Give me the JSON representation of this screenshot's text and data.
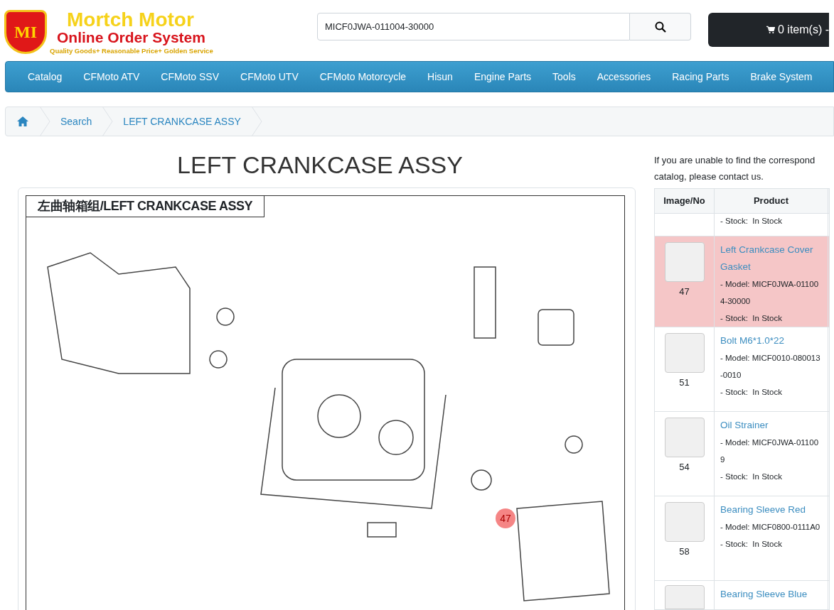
{
  "logo": {
    "mark": "MI",
    "name": "Mortch Motor",
    "subtitle": "Online Order System",
    "tagline": "Quality Goods+ Reasonable Price+ Golden Service"
  },
  "search": {
    "value": "MICF0JWA-011004-30000"
  },
  "cart": {
    "label": "0 item(s) -"
  },
  "nav": [
    "Catalog",
    "CFMoto ATV",
    "CFMoto SSV",
    "CFMoto UTV",
    "CFMoto Motorcycle",
    "Hisun",
    "Engine Parts",
    "Tools",
    "Accessories",
    "Racing Parts",
    "Brake System"
  ],
  "breadcrumb": [
    "Search",
    "LEFT CRANKCASE ASSY"
  ],
  "heading": "LEFT CRANKCASE ASSY",
  "diagram": {
    "title": "左曲轴箱组/LEFT CRANKCASE ASSY",
    "hotspots": [
      {
        "label": "47",
        "selected": true
      }
    ]
  },
  "notice": "If you are unable to find the correspond catalog, please contact us.",
  "table": {
    "columns": [
      "Image/No",
      "Product"
    ],
    "rows": [
      {
        "kind": "partial",
        "stock": "- Stock:  In Stock",
        "selected": false
      },
      {
        "kind": "full",
        "no": "47",
        "name": "Left Crankcase Cover Gasket",
        "model": "- Model: MICF0JWA-011004-30000",
        "stock": "- Stock:  In Stock",
        "selected": true
      },
      {
        "kind": "full",
        "no": "51",
        "name": "Bolt M6*1.0*22",
        "model": "- Model: MICF0010-080013-0010",
        "stock": "- Stock:  In Stock",
        "selected": false
      },
      {
        "kind": "full",
        "no": "54",
        "name": "Oil Strainer",
        "model": "- Model: MICF0JWA-011009",
        "stock": "- Stock:  In Stock",
        "selected": false
      },
      {
        "kind": "full",
        "no": "58",
        "name": "Bearing Sleeve Red",
        "model": "- Model: MICF0800-0111A0",
        "stock": "- Stock:  In Stock",
        "selected": false
      },
      {
        "kind": "cut",
        "name": "Bearing Sleeve Blue",
        "selected": false
      }
    ]
  }
}
